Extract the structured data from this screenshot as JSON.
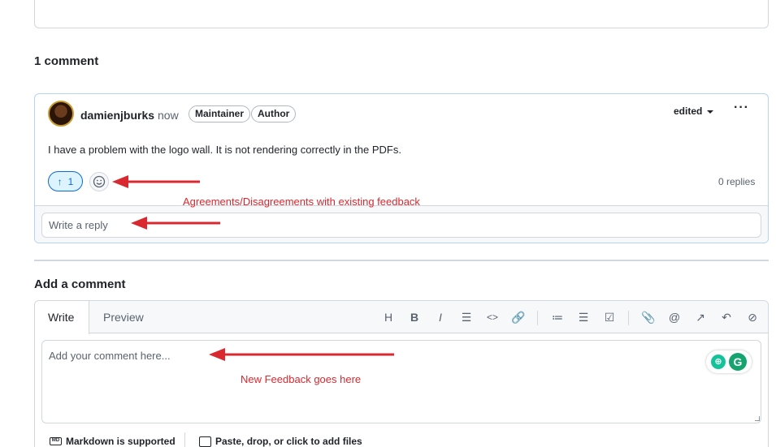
{
  "comments": {
    "heading": "1 comment",
    "items": [
      {
        "author": "damienjburks",
        "time": "now",
        "badges": [
          "Maintainer",
          "Author"
        ],
        "edited_label": "edited",
        "more": "···",
        "body": "I have a problem with the logo wall. It is not rendering correctly in the PDFs.",
        "reaction": {
          "icon": "↑",
          "count": "1"
        },
        "replies": "0 replies",
        "reply_placeholder": "Write a reply"
      }
    ]
  },
  "add_comment": {
    "heading": "Add a comment",
    "tabs": [
      "Write",
      "Preview"
    ],
    "toolbar": [
      {
        "name": "heading-icon",
        "glyph": "H"
      },
      {
        "name": "bold-icon",
        "glyph": "B"
      },
      {
        "name": "italic-icon",
        "glyph": "I"
      },
      {
        "name": "quote-icon",
        "glyph": "☰"
      },
      {
        "name": "code-icon",
        "glyph": "<>"
      },
      {
        "name": "link-icon",
        "glyph": "🔗"
      },
      {
        "name": "ordered-list-icon",
        "glyph": "≔"
      },
      {
        "name": "unordered-list-icon",
        "glyph": "☰"
      },
      {
        "name": "task-list-icon",
        "glyph": "☑"
      },
      {
        "name": "attach-icon",
        "glyph": "📎"
      },
      {
        "name": "mention-icon",
        "glyph": "@"
      },
      {
        "name": "reference-icon",
        "glyph": "↗"
      },
      {
        "name": "undo-icon",
        "glyph": "↶"
      },
      {
        "name": "slash-command-icon",
        "glyph": "⊘"
      }
    ],
    "placeholder": "Add your comment here...",
    "markdown_label": "Markdown is supported",
    "markdown_badge": "MD",
    "paste_label": "Paste, drop, or click to add files",
    "grammarly_logo": "G"
  },
  "annotations": {
    "agreements": "Agreements/Disagreements with existing feedback",
    "new_feedback": "New Feedback goes here",
    "color": "#d9282f"
  },
  "colors": {
    "accent": "#0969da",
    "border": "#d0d7de",
    "grammarly": "#15a36f"
  }
}
